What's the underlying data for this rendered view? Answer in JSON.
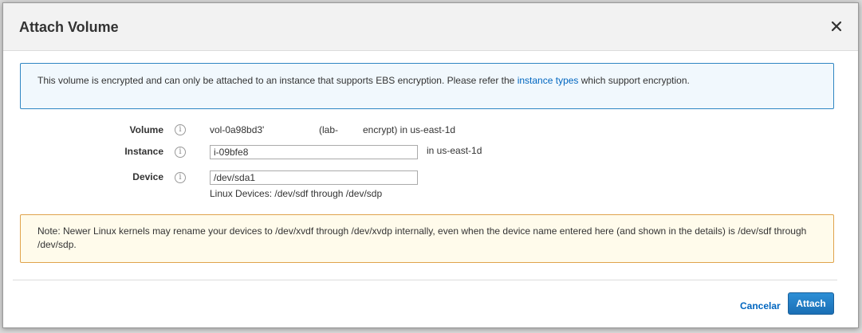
{
  "dialog": {
    "title": "Attach Volume",
    "close_icon": "close-icon"
  },
  "info": {
    "text_before": "This volume is encrypted and can only be attached to an instance that supports EBS encryption. Please refer the",
    "link_text": "instance types",
    "text_after": "which support encryption."
  },
  "form": {
    "volume": {
      "label": "Volume",
      "help_icon": "info-icon",
      "value_id": "vol-0a98bd3'",
      "value_name": "(lab-",
      "value_suffix": "encrypt) in us-east-1d"
    },
    "instance": {
      "label": "Instance",
      "help_icon": "info-icon",
      "value": "i-09bfe8",
      "zone": "in us-east-1d"
    },
    "device": {
      "label": "Device",
      "help_icon": "info-icon",
      "value": "/dev/sda1",
      "hint": "Linux Devices: /dev/sdf through /dev/sdp"
    }
  },
  "note": {
    "text": "Note: Newer Linux kernels may rename your devices to /dev/xvdf through /dev/xvdp internally, even when the device name entered here (and shown in the details) is /dev/sdf through /dev/sdp."
  },
  "footer": {
    "cancel_label": "Cancelar",
    "attach_label": "Attach"
  },
  "colors": {
    "primary": "#1a6fb5",
    "link": "#0066c0",
    "info_border": "#2f86c3",
    "note_border": "#e0a34c"
  }
}
